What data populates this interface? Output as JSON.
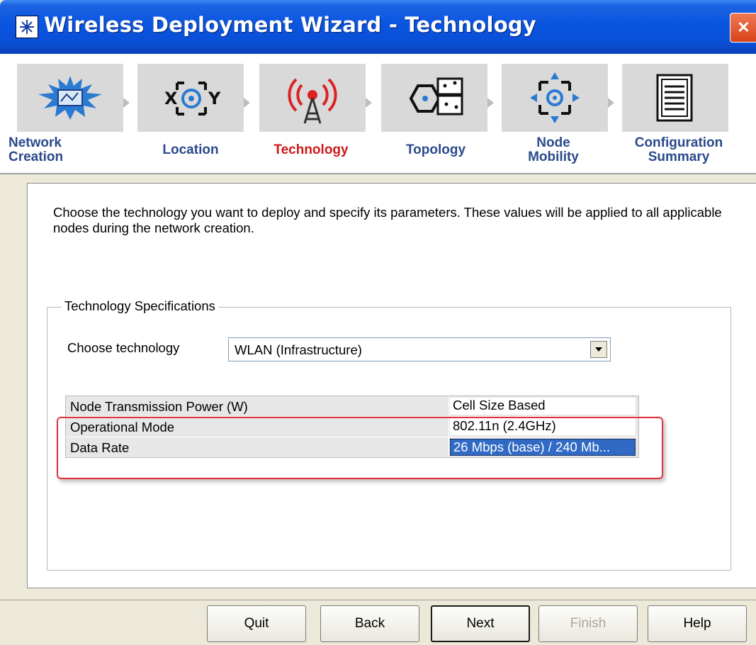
{
  "window": {
    "title": "Wireless Deployment Wizard - Technology",
    "close_glyph": "✕"
  },
  "steps": [
    {
      "label": "Network Creation",
      "icon": "network-icon",
      "state": "done"
    },
    {
      "label": "Location",
      "icon": "location-xy-icon",
      "state": "done"
    },
    {
      "label": "Technology",
      "icon": "antenna-tower-icon",
      "state": "active"
    },
    {
      "label": "Topology",
      "icon": "topology-icon",
      "state": "pending"
    },
    {
      "label": "Node Mobility",
      "icon": "mobility-arrows-icon",
      "state": "pending"
    },
    {
      "label": "Configuration Summary",
      "icon": "document-icon",
      "state": "pending"
    }
  ],
  "intro": "Choose the technology you want to deploy and specify its parameters. These values will be applied to all applicable nodes during the network creation.",
  "group": {
    "title": "Technology Specifications",
    "choose_label": "Choose technology",
    "technology_value": "WLAN (Infrastructure)"
  },
  "parameters": [
    {
      "name": "Node Transmission Power (W)",
      "value": "Cell Size Based",
      "selected": false
    },
    {
      "name": "Operational Mode",
      "value": "802.11n (2.4GHz)",
      "selected": false
    },
    {
      "name": "Data Rate",
      "value": "26 Mbps (base) / 240 Mb...",
      "selected": true
    }
  ],
  "buttons": {
    "quit": "Quit",
    "back": "Back",
    "next": "Next",
    "finish": "Finish",
    "help": "Help"
  },
  "colors": {
    "titlebar": "#0a55e0",
    "active_step": "#cc1a1a",
    "step_label": "#2b4a8b",
    "highlight_box": "#e0303a",
    "selection": "#316ac5"
  }
}
